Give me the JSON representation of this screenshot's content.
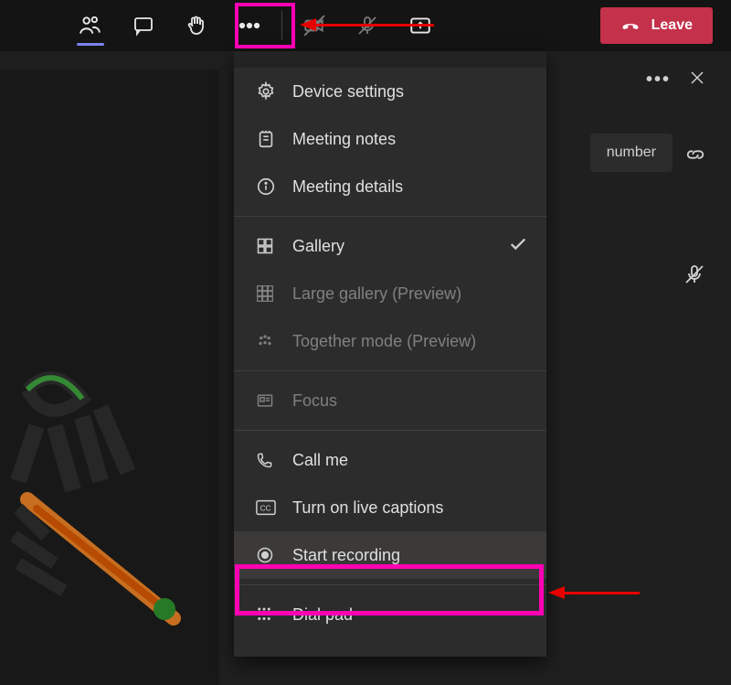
{
  "toolbar": {
    "leave_label": "Leave"
  },
  "menu": {
    "device_settings": "Device settings",
    "meeting_notes": "Meeting notes",
    "meeting_details": "Meeting details",
    "gallery": "Gallery",
    "large_gallery": "Large gallery (Preview)",
    "together_mode": "Together mode (Preview)",
    "focus": "Focus",
    "call_me": "Call me",
    "live_captions": "Turn on live captions",
    "start_recording": "Start recording",
    "dial_pad": "Dial pad"
  },
  "panel": {
    "chip_text": "number"
  }
}
